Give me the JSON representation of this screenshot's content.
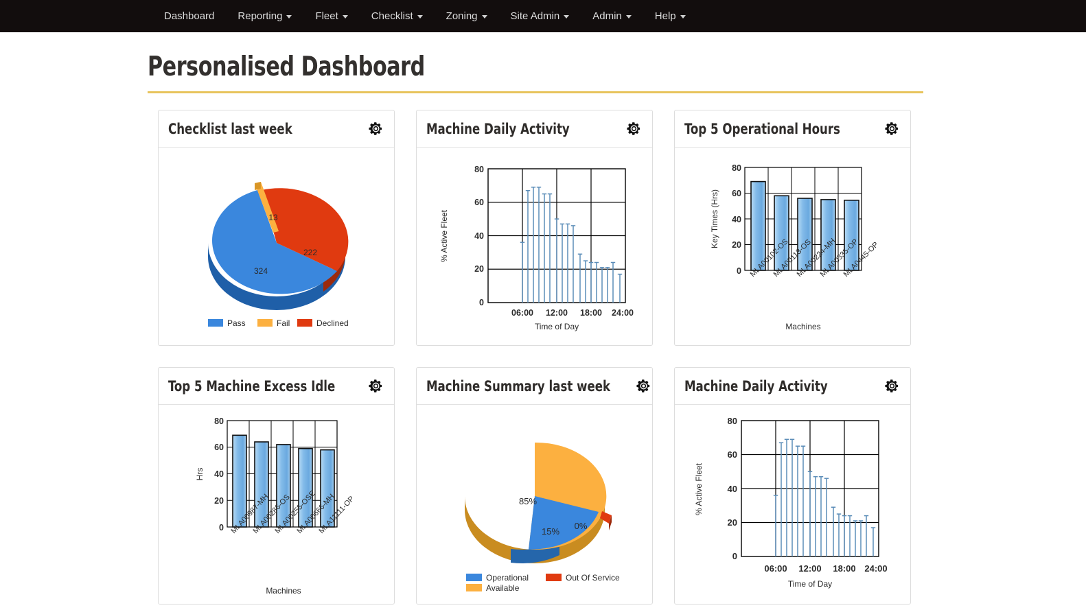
{
  "navbar": {
    "items": [
      {
        "label": "Dashboard",
        "caret": false
      },
      {
        "label": "Reporting",
        "caret": true
      },
      {
        "label": "Fleet",
        "caret": true
      },
      {
        "label": "Checklist",
        "caret": true
      },
      {
        "label": "Zoning",
        "caret": true
      },
      {
        "label": "Site Admin",
        "caret": true
      },
      {
        "label": "Admin",
        "caret": true
      },
      {
        "label": "Help",
        "caret": true
      }
    ]
  },
  "page": {
    "title": "Personalised Dashboard"
  },
  "colors": {
    "accent_rule": "#e8c45c",
    "navbar_bg": "#120d0d",
    "pie_blue": "#3a87dd",
    "pie_orange": "#fcb040",
    "pie_red": "#e03a10",
    "bar_blue": "#7fb8e8",
    "needle_blue": "#5b8db8"
  },
  "cards": [
    {
      "id": "checklist-last-week",
      "title": "Checklist last week",
      "gear_icon": "gear-icon"
    },
    {
      "id": "machine-daily-activity-1",
      "title": "Machine Daily Activity",
      "gear_icon": "gear-icon"
    },
    {
      "id": "top-5-operational-hours",
      "title": "Top 5 Operational Hours",
      "gear_icon": "gear-icon"
    },
    {
      "id": "top-5-machine-excess-idle",
      "title": "Top 5 Machine Excess Idle",
      "gear_icon": "gear-icon"
    },
    {
      "id": "machine-summary-last-week",
      "title": "Machine Summary last week",
      "gear_icon": "gear-icon"
    },
    {
      "id": "machine-daily-activity-2",
      "title": "Machine Daily Activity",
      "gear_icon": "gear-icon"
    }
  ],
  "chart_data": [
    {
      "type": "pie",
      "title": "Checklist last week",
      "labels": [
        "Pass",
        "Fail",
        "Declined"
      ],
      "values": [
        324,
        13,
        222
      ],
      "data_labels": [
        "324",
        "13",
        "222"
      ],
      "colors": [
        "#3a87dd",
        "#fcb040",
        "#e03a10"
      ],
      "legend": [
        "Pass",
        "Fail",
        "Declined"
      ],
      "legend_position": "bottom",
      "three_d": true
    },
    {
      "type": "bar",
      "title": "Machine Daily Activity",
      "xlabel": "Time of Day",
      "ylabel": "% Active Fleet",
      "ylim": [
        0,
        80
      ],
      "yticks": [
        0,
        20,
        40,
        60,
        80
      ],
      "xticks": [
        "06:00",
        "12:00",
        "18:00",
        "24:00"
      ],
      "x": [
        6,
        7,
        8,
        9,
        10,
        11,
        12,
        13,
        14,
        15,
        16,
        17,
        18,
        19,
        20,
        21,
        22,
        23
      ],
      "values": [
        36,
        67,
        69,
        69,
        65,
        65,
        50,
        47,
        47,
        46,
        29,
        25,
        24,
        24,
        21,
        21,
        24,
        17
      ],
      "grid": true,
      "style": "needle"
    },
    {
      "type": "bar",
      "title": "Top 5 Operational Hours",
      "xlabel": "Machines",
      "ylabel": "Key Times (Hrs)",
      "ylim": [
        0,
        80
      ],
      "yticks": [
        0,
        20,
        40,
        60,
        80
      ],
      "categories": [
        "MLA00102-OS",
        "MLA00113-OS",
        "MLA00224-MH",
        "MLA00335-OP",
        "MLA0445-OP"
      ],
      "values": [
        69,
        58,
        56,
        55,
        54.5
      ],
      "grid": true
    },
    {
      "type": "bar",
      "title": "Top 5 Machine Excess Idle",
      "xlabel": "Machines",
      "ylabel": "Hrs",
      "ylim": [
        0,
        80
      ],
      "yticks": [
        0,
        20,
        40,
        60,
        80
      ],
      "categories": [
        "MLA00987-MH",
        "MLA00286-OS",
        "MLA00255-OSE",
        "MLA00666-MH",
        "MLA11111-OP"
      ],
      "values": [
        69,
        64,
        62,
        59,
        58
      ],
      "grid": true
    },
    {
      "type": "pie",
      "title": "Machine Summary last week",
      "labels": [
        "Operational",
        "Available",
        "Out Of Service"
      ],
      "values": [
        15,
        85,
        0
      ],
      "data_labels": [
        "15%",
        "85%",
        "0%"
      ],
      "colors": [
        "#3a87dd",
        "#fcb040",
        "#e03a10"
      ],
      "legend": [
        "Operational",
        "Available",
        "Out Of Service"
      ],
      "legend_position": "bottom",
      "three_d": true
    },
    {
      "type": "bar",
      "title": "Machine Daily Activity",
      "xlabel": "Time of Day",
      "ylabel": "% Active Fleet",
      "ylim": [
        0,
        80
      ],
      "yticks": [
        0,
        20,
        40,
        60,
        80
      ],
      "xticks": [
        "06:00",
        "12:00",
        "18:00",
        "24:00"
      ],
      "x": [
        6,
        7,
        8,
        9,
        10,
        11,
        12,
        13,
        14,
        15,
        16,
        17,
        18,
        19,
        20,
        21,
        22,
        23
      ],
      "values": [
        36,
        67,
        69,
        69,
        65,
        65,
        50,
        47,
        47,
        46,
        29,
        25,
        24,
        24,
        21,
        21,
        24,
        17
      ],
      "grid": true,
      "style": "needle"
    }
  ]
}
